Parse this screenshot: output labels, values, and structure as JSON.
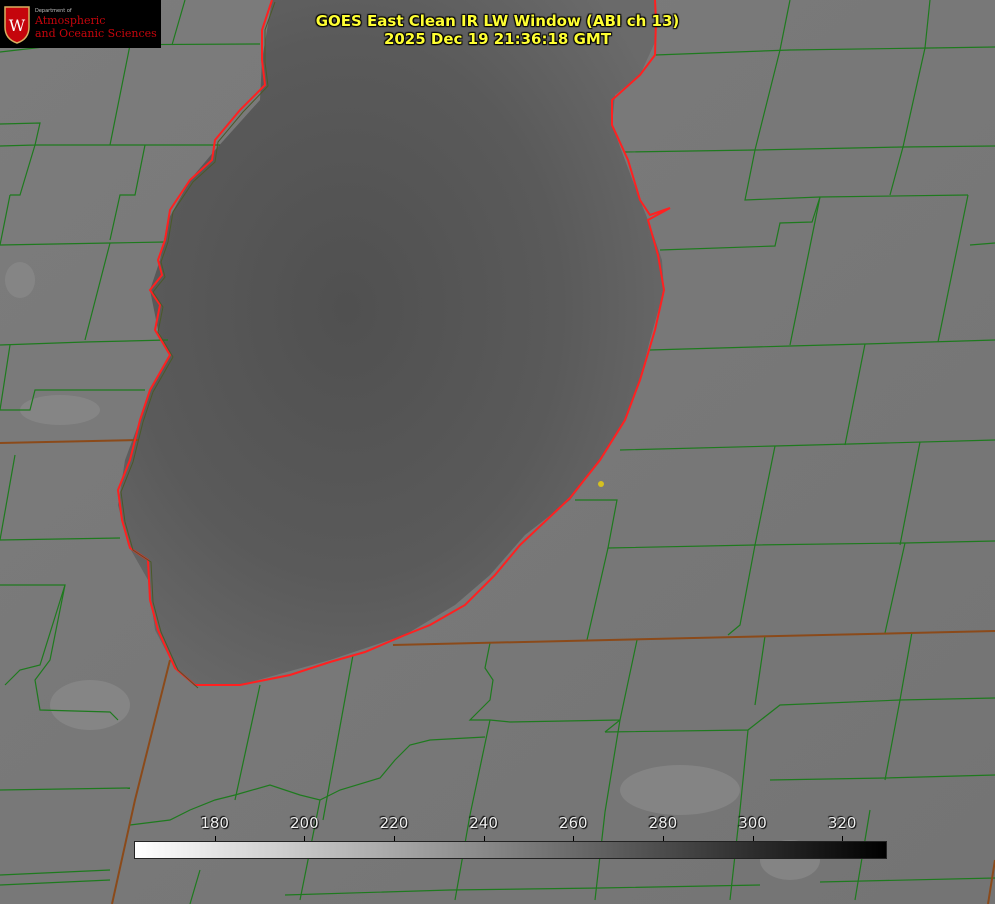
{
  "logo": {
    "small_text": "Department of",
    "line1": "Atmospheric",
    "line2": "and Oceanic Sciences",
    "seal_letter": "W",
    "colors": {
      "red": "#c5050c",
      "background": "#000000"
    }
  },
  "title": {
    "line1": "GOES East Clean IR LW Window (ABI ch 13)",
    "line2": "2025 Dec 19 21:36:18 GMT",
    "color": "#ffff33"
  },
  "colorbar": {
    "ticks": [
      "180",
      "200",
      "220",
      "240",
      "260",
      "280",
      "300",
      "320"
    ],
    "min_value": 162,
    "max_value": 330,
    "gradient": [
      "#ffffff",
      "#000000"
    ]
  },
  "map_layers": {
    "county_border_color": "#1e7a1e",
    "state_border_color": "#8b4a1a",
    "coastline_color": "#ff2020",
    "lake_color": "#555555",
    "land_color": "#7a7a7a",
    "marker_color": "#d4c020"
  }
}
